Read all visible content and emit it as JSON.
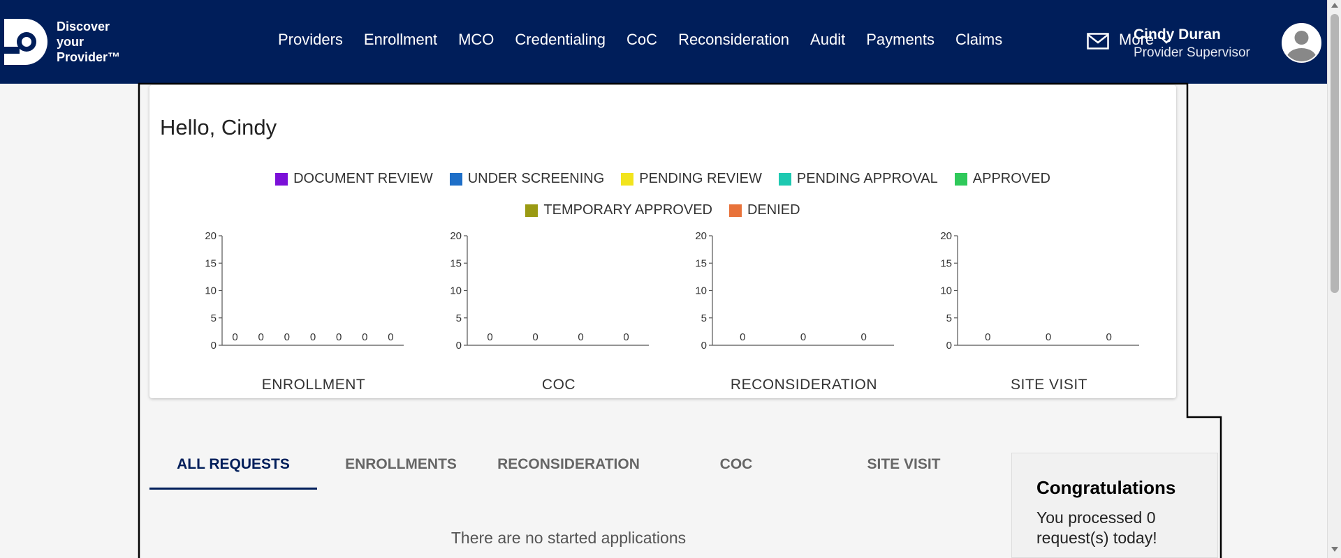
{
  "app": {
    "logo_lines": [
      "Discover",
      "your",
      "Provider™"
    ],
    "logo_icon": "discover-provider-logo"
  },
  "nav": {
    "items": [
      "Providers",
      "Enrollment",
      "MCO",
      "Credentialing",
      "CoC",
      "Reconsideration",
      "Audit",
      "Payments",
      "Claims"
    ],
    "more_label": "More",
    "more_icon": "chevron-down-icon",
    "mail_icon": "mail-icon"
  },
  "user": {
    "name": "Cindy Duran",
    "role": "Provider Supervisor",
    "avatar_icon": "user-avatar-icon"
  },
  "dashboard": {
    "greeting": "Hello, Cindy",
    "legend": [
      {
        "label": "DOCUMENT REVIEW",
        "color": "#7b10d8"
      },
      {
        "label": "UNDER SCREENING",
        "color": "#1e6fc8"
      },
      {
        "label": "PENDING REVIEW",
        "color": "#f2e41d"
      },
      {
        "label": "PENDING APPROVAL",
        "color": "#1ec9b1"
      },
      {
        "label": "APPROVED",
        "color": "#2fc95a"
      },
      {
        "label": "TEMPORARY APPROVED",
        "color": "#9a9a13"
      },
      {
        "label": "DENIED",
        "color": "#e8723a"
      }
    ]
  },
  "chart_data": [
    {
      "type": "bar",
      "title": "ENROLLMENT",
      "values": [
        0,
        0,
        0,
        0,
        0,
        0,
        0
      ],
      "ylim": [
        0,
        20
      ],
      "yticks": [
        0,
        5,
        10,
        15,
        20
      ]
    },
    {
      "type": "bar",
      "title": "COC",
      "values": [
        0,
        0,
        0,
        0
      ],
      "ylim": [
        0,
        20
      ],
      "yticks": [
        0,
        5,
        10,
        15,
        20
      ]
    },
    {
      "type": "bar",
      "title": "RECONSIDERATION",
      "values": [
        0,
        0,
        0
      ],
      "ylim": [
        0,
        20
      ],
      "yticks": [
        0,
        5,
        10,
        15,
        20
      ]
    },
    {
      "type": "bar",
      "title": "SITE VISIT",
      "values": [
        0,
        0,
        0
      ],
      "ylim": [
        0,
        20
      ],
      "yticks": [
        0,
        5,
        10,
        15,
        20
      ]
    }
  ],
  "tabs": [
    "ALL REQUESTS",
    "ENROLLMENTS",
    "RECONSIDERATION",
    "COC",
    "SITE VISIT"
  ],
  "active_tab": 0,
  "empty_message": "There are no started applications",
  "congrats": {
    "title": "Congratulations",
    "text": "You processed 0 request(s) today!"
  },
  "colors": {
    "header_bg": "#001e5a",
    "accent": "#001e5a"
  }
}
